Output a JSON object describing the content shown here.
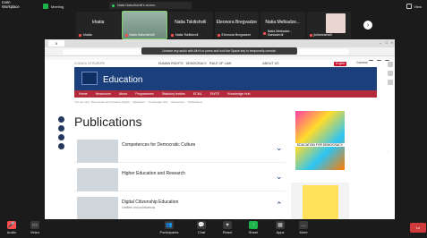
{
  "topbar": {
    "brand_line1": "room",
    "brand_line2": "Workplace",
    "meeting": "Meeting",
    "view": "View",
    "sharing_label": "Natia Natsvlishvili's screen"
  },
  "participants": [
    {
      "name": "khatia",
      "label": "khatia"
    },
    {
      "name": "",
      "label": "Natia Natsvlishvili"
    },
    {
      "name": "Natia Tskitishvili",
      "label": "Natia Tskitishvili"
    },
    {
      "name": "Eleonora Bregvadze",
      "label": "Eleonora Bregvadze"
    },
    {
      "name": "Natia Melkadze...",
      "label": "Natia Melkadze - Ganiashvili"
    },
    {
      "name": "",
      "label": "jiuliamoshvili"
    }
  ],
  "browser": {
    "tab_label": "5",
    "toast": "Unmute any audio with Alt+A or press and hold the Space key to temporarily unmute.",
    "bookmarks": "Bookmarks"
  },
  "site": {
    "org_small": "COUNCIL OF EUROPE",
    "nav_links": [
      "HUMAN RIGHTS",
      "DEMOCRACY",
      "RULE OF LAW"
    ],
    "about": "ABOUT US",
    "language": "English",
    "connect": "Connect",
    "banner_title": "Education",
    "menu": [
      "Home",
      "Newsroom",
      "About",
      "Programmes",
      "Statutory bodies",
      "ECML",
      "EWTE",
      "Knowledge Hub"
    ],
    "breadcrumb": "You are here: Democratic and Inclusive Digital ... Education ... Knowledge Hub ... Resources ... Publications",
    "page_title": "Publications",
    "items": [
      {
        "title": "Competences for Democratic Culture",
        "subtitle": ""
      },
      {
        "title": "Higher Education and Research",
        "subtitle": ""
      },
      {
        "title": "Digital Citizenship Education",
        "subtitle": "Leaflets and publications"
      }
    ],
    "ad_caption": "EDUCATION FOR DEMOCRACY"
  },
  "controls": [
    {
      "label": "Audio",
      "icon": "mic-off-icon"
    },
    {
      "label": "Video",
      "icon": "video-off-icon"
    },
    {
      "label": "Participants",
      "icon": "participants-icon"
    },
    {
      "label": "Chat",
      "icon": "chat-icon"
    },
    {
      "label": "React",
      "icon": "react-icon"
    },
    {
      "label": "Share",
      "icon": "share-icon"
    },
    {
      "label": "Apps",
      "icon": "apps-icon"
    },
    {
      "label": "More",
      "icon": "more-icon"
    }
  ],
  "participants_count": "16",
  "leave_label": "Le"
}
